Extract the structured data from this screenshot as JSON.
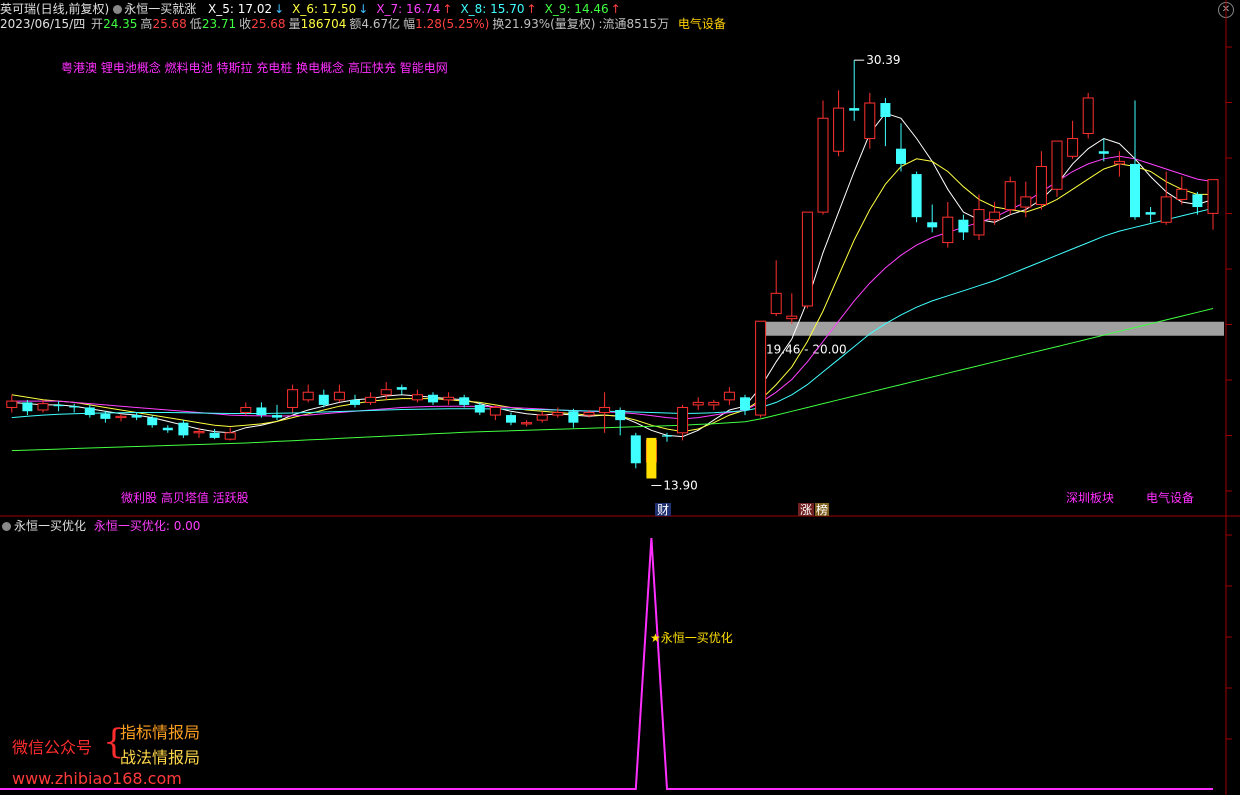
{
  "header": {
    "stock_name": "英可瑞(日线,前复权)",
    "indicator_name": "永恒一买就涨",
    "mas": [
      {
        "label": "X_5: 17.02",
        "arrow": "↓",
        "color": "#ffffff",
        "arrow_color": "#40c0ff"
      },
      {
        "label": "X_6: 17.50",
        "arrow": "↓",
        "color": "#ffff40",
        "arrow_color": "#40c0ff"
      },
      {
        "label": "X_7: 16.74",
        "arrow": "↑",
        "color": "#ff40ff",
        "arrow_color": "#ff4040"
      },
      {
        "label": "X_8: 15.70",
        "arrow": "↑",
        "color": "#40ffff",
        "arrow_color": "#ff4040"
      },
      {
        "label": "X_9: 14.46",
        "arrow": "↑",
        "color": "#40ff40",
        "arrow_color": "#ff4040"
      }
    ],
    "date": "2023/06/15/四",
    "quote": [
      {
        "k": "开",
        "v": "24.35",
        "color": "#40ff40"
      },
      {
        "k": "高",
        "v": "25.68",
        "color": "#ff4040"
      },
      {
        "k": "低",
        "v": "23.71",
        "color": "#40ff40"
      },
      {
        "k": "收",
        "v": "25.68",
        "color": "#ff4040"
      },
      {
        "k": "量",
        "v": "186704",
        "color": "#ffff40"
      },
      {
        "k": "额",
        "v": "4.67亿",
        "color": "#c0c0c0"
      },
      {
        "k": "幅",
        "v": "1.28(5.25%)",
        "color": "#ff4040"
      },
      {
        "k": "换",
        "v": "21.93%(量复权)",
        "color": "#c0c0c0"
      },
      {
        "k": ":流通",
        "v": "8515万",
        "color": "#c0c0c0"
      }
    ],
    "industry": "电气设备",
    "close_icon": "close-icon"
  },
  "main_panel": {
    "concepts_top": "粤港澳 锂电池概念 燃料电池 特斯拉 充电桩 换电概念 高压快充 智能电网",
    "concepts_bottom_left": "微利股 高贝塔值 活跃股",
    "concepts_bottom_right_1": "深圳板块",
    "concepts_bottom_right_2": "电气设备",
    "high_marker": "30.39",
    "low_marker": "13.90",
    "zone_label": "19.46 - 20.00",
    "badge_cai": "财",
    "badge_zhang": "涨",
    "badge_bang": "榜"
  },
  "sub_panel": {
    "title": "永恒一买优化",
    "value_label": "永恒一买优化: 0.00",
    "signal_label": "★永恒一买优化"
  },
  "watermark": {
    "wechat": "微信公众号",
    "line1": "指标情报局",
    "line2": "战法情报局",
    "url": "www.zhibiao168.com"
  },
  "chart_data": {
    "type": "candlestick",
    "price_range_visible": [
      13.9,
      30.39
    ],
    "candles": [
      {
        "o": 16.7,
        "c": 16.95,
        "h": 17.2,
        "l": 16.5
      },
      {
        "o": 16.9,
        "c": 16.55,
        "h": 17.0,
        "l": 16.4
      },
      {
        "o": 16.6,
        "c": 16.85,
        "h": 17.0,
        "l": 16.5
      },
      {
        "o": 16.8,
        "c": 16.75,
        "h": 16.95,
        "l": 16.55
      },
      {
        "o": 16.75,
        "c": 16.7,
        "h": 16.85,
        "l": 16.5
      },
      {
        "o": 16.7,
        "c": 16.4,
        "h": 16.8,
        "l": 16.3
      },
      {
        "o": 16.45,
        "c": 16.25,
        "h": 16.55,
        "l": 16.1
      },
      {
        "o": 16.3,
        "c": 16.35,
        "h": 16.45,
        "l": 16.15
      },
      {
        "o": 16.4,
        "c": 16.3,
        "h": 16.5,
        "l": 16.2
      },
      {
        "o": 16.3,
        "c": 16.0,
        "h": 16.4,
        "l": 15.9
      },
      {
        "o": 15.9,
        "c": 15.8,
        "h": 16.0,
        "l": 15.7
      },
      {
        "o": 16.1,
        "c": 15.6,
        "h": 16.2,
        "l": 15.5
      },
      {
        "o": 15.7,
        "c": 15.75,
        "h": 15.9,
        "l": 15.5
      },
      {
        "o": 15.7,
        "c": 15.5,
        "h": 15.85,
        "l": 15.45
      },
      {
        "o": 15.45,
        "c": 15.7,
        "h": 15.9,
        "l": 15.4
      },
      {
        "o": 16.5,
        "c": 16.7,
        "h": 16.9,
        "l": 16.4
      },
      {
        "o": 16.7,
        "c": 16.4,
        "h": 16.9,
        "l": 16.3
      },
      {
        "o": 16.4,
        "c": 16.3,
        "h": 16.8,
        "l": 16.2
      },
      {
        "o": 16.7,
        "c": 17.4,
        "h": 17.6,
        "l": 16.5
      },
      {
        "o": 17.0,
        "c": 17.3,
        "h": 17.6,
        "l": 16.9
      },
      {
        "o": 17.2,
        "c": 16.8,
        "h": 17.4,
        "l": 16.7
      },
      {
        "o": 17.0,
        "c": 17.3,
        "h": 17.6,
        "l": 16.9
      },
      {
        "o": 17.0,
        "c": 16.8,
        "h": 17.2,
        "l": 16.7
      },
      {
        "o": 16.9,
        "c": 17.1,
        "h": 17.3,
        "l": 16.8
      },
      {
        "o": 17.2,
        "c": 17.4,
        "h": 17.7,
        "l": 17.0
      },
      {
        "o": 17.5,
        "c": 17.4,
        "h": 17.6,
        "l": 17.2
      },
      {
        "o": 17.0,
        "c": 17.2,
        "h": 17.4,
        "l": 16.9
      },
      {
        "o": 17.2,
        "c": 16.9,
        "h": 17.3,
        "l": 16.8
      },
      {
        "o": 17.0,
        "c": 17.1,
        "h": 17.3,
        "l": 16.8
      },
      {
        "o": 17.1,
        "c": 16.8,
        "h": 17.2,
        "l": 16.7
      },
      {
        "o": 16.8,
        "c": 16.5,
        "h": 16.9,
        "l": 16.4
      },
      {
        "o": 16.4,
        "c": 16.7,
        "h": 16.8,
        "l": 16.2
      },
      {
        "o": 16.4,
        "c": 16.1,
        "h": 16.5,
        "l": 16.0
      },
      {
        "o": 16.05,
        "c": 16.1,
        "h": 16.2,
        "l": 15.95
      },
      {
        "o": 16.2,
        "c": 16.4,
        "h": 16.55,
        "l": 16.1
      },
      {
        "o": 16.4,
        "c": 16.5,
        "h": 16.7,
        "l": 16.3
      },
      {
        "o": 16.55,
        "c": 16.1,
        "h": 16.65,
        "l": 15.9
      },
      {
        "o": 16.4,
        "c": 16.5,
        "h": 16.6,
        "l": 16.3
      },
      {
        "o": 16.5,
        "c": 16.7,
        "h": 17.3,
        "l": 15.7
      },
      {
        "o": 16.6,
        "c": 16.2,
        "h": 16.7,
        "l": 15.6
      },
      {
        "o": 15.6,
        "c": 14.5,
        "h": 15.7,
        "l": 14.3
      },
      {
        "o": 14.55,
        "c": 15.4,
        "h": 15.5,
        "l": 13.9
      },
      {
        "o": 15.6,
        "c": 15.55,
        "h": 15.7,
        "l": 15.35
      },
      {
        "o": 15.7,
        "c": 16.7,
        "h": 16.8,
        "l": 15.4
      },
      {
        "o": 16.8,
        "c": 16.9,
        "h": 17.1,
        "l": 16.6
      },
      {
        "o": 16.8,
        "c": 16.9,
        "h": 17.0,
        "l": 16.6
      },
      {
        "o": 17.0,
        "c": 17.3,
        "h": 17.5,
        "l": 16.8
      },
      {
        "o": 17.1,
        "c": 16.6,
        "h": 17.2,
        "l": 16.4
      },
      {
        "o": 16.4,
        "c": 20.1,
        "h": 20.1,
        "l": 16.3
      },
      {
        "o": 20.4,
        "c": 21.2,
        "h": 22.5,
        "l": 20.3
      },
      {
        "o": 20.2,
        "c": 20.3,
        "h": 21.2,
        "l": 20.0
      },
      {
        "o": 20.7,
        "c": 24.4,
        "h": 24.4,
        "l": 20.6
      },
      {
        "o": 24.4,
        "c": 28.1,
        "h": 28.8,
        "l": 24.3
      },
      {
        "o": 26.8,
        "c": 28.5,
        "h": 29.2,
        "l": 26.6
      },
      {
        "o": 28.5,
        "c": 28.4,
        "h": 30.39,
        "l": 28.0
      },
      {
        "o": 27.3,
        "c": 28.7,
        "h": 29.1,
        "l": 26.9
      },
      {
        "o": 28.7,
        "c": 28.15,
        "h": 28.9,
        "l": 27.0
      },
      {
        "o": 26.9,
        "c": 26.3,
        "h": 27.9,
        "l": 26.0
      },
      {
        "o": 25.9,
        "c": 24.2,
        "h": 26.0,
        "l": 24.0
      },
      {
        "o": 24.0,
        "c": 23.8,
        "h": 24.7,
        "l": 23.6
      },
      {
        "o": 23.2,
        "c": 24.2,
        "h": 24.8,
        "l": 23.0
      },
      {
        "o": 24.1,
        "c": 23.6,
        "h": 24.3,
        "l": 23.3
      },
      {
        "o": 23.5,
        "c": 24.5,
        "h": 25.1,
        "l": 23.3
      },
      {
        "o": 24.1,
        "c": 24.4,
        "h": 24.8,
        "l": 23.9
      },
      {
        "o": 24.5,
        "c": 25.6,
        "h": 25.8,
        "l": 24.3
      },
      {
        "o": 24.6,
        "c": 25.0,
        "h": 25.6,
        "l": 24.2
      },
      {
        "o": 24.7,
        "c": 26.2,
        "h": 26.8,
        "l": 24.5
      },
      {
        "o": 25.3,
        "c": 27.2,
        "h": 27.2,
        "l": 25.0
      },
      {
        "o": 26.6,
        "c": 27.3,
        "h": 28.0,
        "l": 26.5
      },
      {
        "o": 27.5,
        "c": 28.9,
        "h": 29.1,
        "l": 27.3
      },
      {
        "o": 26.8,
        "c": 26.7,
        "h": 27.3,
        "l": 26.4
      },
      {
        "o": 26.3,
        "c": 26.4,
        "h": 26.8,
        "l": 25.8
      },
      {
        "o": 26.3,
        "c": 24.2,
        "h": 28.8,
        "l": 24.1
      },
      {
        "o": 24.4,
        "c": 24.3,
        "h": 24.6,
        "l": 24.0
      },
      {
        "o": 24.0,
        "c": 25.0,
        "h": 26.0,
        "l": 23.9
      },
      {
        "o": 24.9,
        "c": 25.3,
        "h": 25.8,
        "l": 24.7
      },
      {
        "o": 25.1,
        "c": 24.6,
        "h": 25.2,
        "l": 24.3
      },
      {
        "o": 24.35,
        "c": 25.68,
        "h": 25.68,
        "l": 23.71
      }
    ],
    "ma_lines": [
      {
        "name": "X_5",
        "color": "#ffffff",
        "values": [
          16.9,
          16.85,
          16.8,
          16.8,
          16.75,
          16.65,
          16.55,
          16.45,
          16.4,
          16.3,
          16.15,
          16.0,
          15.85,
          15.75,
          15.7,
          15.9,
          16.0,
          16.15,
          16.4,
          16.6,
          16.75,
          16.9,
          17.0,
          17.05,
          17.15,
          17.2,
          17.15,
          17.1,
          17.05,
          17.0,
          16.85,
          16.7,
          16.55,
          16.45,
          16.4,
          16.45,
          16.4,
          16.35,
          16.4,
          16.35,
          16.1,
          15.8,
          15.6,
          15.55,
          15.8,
          16.2,
          16.6,
          16.75,
          17.5,
          18.5,
          19.4,
          20.9,
          22.8,
          24.4,
          26.0,
          27.5,
          28.3,
          28.1,
          27.3,
          26.4,
          25.3,
          24.4,
          24.1,
          24.0,
          24.3,
          24.5,
          24.9,
          25.5,
          26.3,
          26.9,
          27.3,
          27.1,
          26.5,
          25.8,
          25.2,
          24.8,
          24.7,
          24.9
        ]
      },
      {
        "name": "X_6",
        "color": "#ffff40",
        "values": [
          17.2,
          17.1,
          17.0,
          16.95,
          16.9,
          16.8,
          16.7,
          16.6,
          16.5,
          16.4,
          16.3,
          16.2,
          16.1,
          16.0,
          15.95,
          16.0,
          16.05,
          16.15,
          16.3,
          16.45,
          16.6,
          16.75,
          16.85,
          16.95,
          17.0,
          17.05,
          17.05,
          17.05,
          17.0,
          16.95,
          16.9,
          16.8,
          16.7,
          16.6,
          16.55,
          16.5,
          16.45,
          16.4,
          16.4,
          16.35,
          16.2,
          16.0,
          15.85,
          15.75,
          15.85,
          16.1,
          16.4,
          16.6,
          17.0,
          17.6,
          18.3,
          19.3,
          20.5,
          21.9,
          23.3,
          24.5,
          25.5,
          26.2,
          26.5,
          26.4,
          26.0,
          25.4,
          24.9,
          24.6,
          24.5,
          24.4,
          24.6,
          24.9,
          25.3,
          25.7,
          26.1,
          26.3,
          26.2,
          26.0,
          25.6,
          25.3,
          25.1,
          25.1
        ]
      },
      {
        "name": "X_7",
        "color": "#ff40ff",
        "values": [
          16.95,
          16.95,
          16.95,
          16.95,
          16.9,
          16.85,
          16.8,
          16.75,
          16.7,
          16.65,
          16.6,
          16.55,
          16.5,
          16.45,
          16.4,
          16.38,
          16.37,
          16.36,
          16.37,
          16.4,
          16.45,
          16.5,
          16.55,
          16.6,
          16.65,
          16.7,
          16.72,
          16.74,
          16.75,
          16.75,
          16.74,
          16.72,
          16.7,
          16.67,
          16.64,
          16.6,
          16.57,
          16.55,
          16.53,
          16.5,
          16.45,
          16.38,
          16.3,
          16.25,
          16.3,
          16.4,
          16.5,
          16.6,
          16.9,
          17.3,
          17.8,
          18.5,
          19.3,
          20.1,
          20.9,
          21.6,
          22.2,
          22.7,
          23.1,
          23.4,
          23.6,
          23.8,
          24.0,
          24.2,
          24.5,
          24.8,
          25.2,
          25.6,
          26.0,
          26.3,
          26.5,
          26.6,
          26.5,
          26.3,
          26.1,
          25.9,
          25.7,
          25.6
        ]
      },
      {
        "name": "X_8",
        "color": "#40ffff",
        "values": [
          16.3,
          16.35,
          16.4,
          16.43,
          16.45,
          16.47,
          16.48,
          16.49,
          16.5,
          16.5,
          16.5,
          16.49,
          16.48,
          16.47,
          16.46,
          16.46,
          16.46,
          16.47,
          16.48,
          16.5,
          16.52,
          16.54,
          16.56,
          16.58,
          16.6,
          16.62,
          16.63,
          16.64,
          16.65,
          16.65,
          16.65,
          16.64,
          16.63,
          16.62,
          16.61,
          16.6,
          16.58,
          16.56,
          16.55,
          16.54,
          16.52,
          16.5,
          16.48,
          16.46,
          16.47,
          16.49,
          16.53,
          16.57,
          16.7,
          16.9,
          17.2,
          17.6,
          18.1,
          18.6,
          19.1,
          19.6,
          20.0,
          20.35,
          20.65,
          20.9,
          21.1,
          21.3,
          21.5,
          21.7,
          21.95,
          22.2,
          22.45,
          22.7,
          22.95,
          23.2,
          23.45,
          23.65,
          23.8,
          23.95,
          24.1,
          24.25,
          24.4,
          24.55
        ]
      },
      {
        "name": "X_9",
        "color": "#40ff40",
        "values": [
          15.0,
          15.02,
          15.04,
          15.06,
          15.08,
          15.1,
          15.12,
          15.14,
          15.16,
          15.18,
          15.2,
          15.22,
          15.24,
          15.26,
          15.28,
          15.3,
          15.33,
          15.36,
          15.39,
          15.42,
          15.45,
          15.48,
          15.51,
          15.54,
          15.57,
          15.6,
          15.63,
          15.66,
          15.69,
          15.72,
          15.74,
          15.76,
          15.78,
          15.8,
          15.82,
          15.84,
          15.86,
          15.88,
          15.9,
          15.92,
          15.94,
          15.96,
          15.98,
          16.0,
          16.03,
          16.06,
          16.1,
          16.14,
          16.25,
          16.4,
          16.55,
          16.7,
          16.85,
          17.0,
          17.15,
          17.3,
          17.45,
          17.6,
          17.75,
          17.9,
          18.05,
          18.2,
          18.35,
          18.5,
          18.65,
          18.8,
          18.95,
          19.1,
          19.25,
          19.4,
          19.55,
          19.7,
          19.85,
          20.0,
          20.15,
          20.3,
          20.45,
          20.6
        ]
      }
    ],
    "zone": {
      "low": 19.46,
      "high": 20.0
    },
    "signal": {
      "series_name": "永恒一买优化",
      "ylim": [
        0,
        1
      ],
      "peak_index": 41,
      "value": 0.0
    }
  },
  "colors": {
    "up": "#ff3030",
    "down": "#40ffff",
    "signal_line": "#ff30ff",
    "grid": "#800000",
    "axis": "#a00000"
  }
}
